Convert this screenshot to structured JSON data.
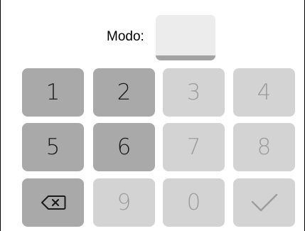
{
  "mode": {
    "label": "Modo:",
    "value": ""
  },
  "keypad": {
    "keys": [
      {
        "label": "1",
        "state": "active"
      },
      {
        "label": "2",
        "state": "active"
      },
      {
        "label": "3",
        "state": "disabled"
      },
      {
        "label": "4",
        "state": "disabled"
      },
      {
        "label": "5",
        "state": "active"
      },
      {
        "label": "6",
        "state": "active"
      },
      {
        "label": "7",
        "state": "disabled"
      },
      {
        "label": "8",
        "state": "disabled"
      },
      {
        "label": "",
        "icon": "backspace-icon",
        "state": "active"
      },
      {
        "label": "9",
        "state": "disabled"
      },
      {
        "label": "0",
        "state": "disabled"
      },
      {
        "label": "",
        "icon": "checkmark-icon",
        "state": "disabled"
      }
    ]
  },
  "colors": {
    "active_key": "#a9a9a9",
    "disabled_key": "#d3d3d3",
    "field_bg": "#ececec",
    "field_underline": "#a3a3a3"
  }
}
